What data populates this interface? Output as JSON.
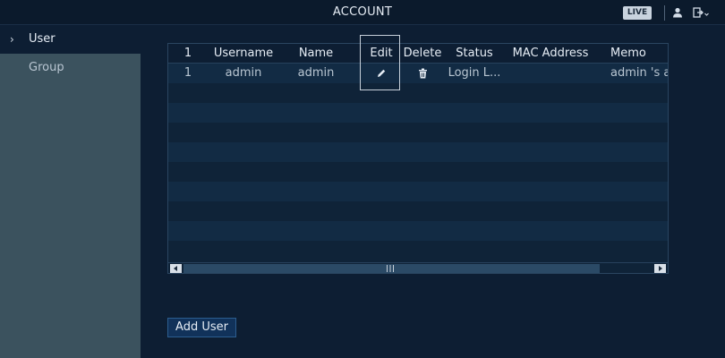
{
  "header": {
    "title": "ACCOUNT",
    "live_label": "LIVE"
  },
  "sidebar": {
    "items": [
      {
        "label": "User",
        "active": true
      },
      {
        "label": "Group",
        "active": false
      }
    ]
  },
  "table": {
    "columns": [
      "1",
      "Username",
      "Name",
      "Edit",
      "Delete",
      "Status",
      "MAC Address",
      "Memo"
    ],
    "memo_header_visible": "Memo",
    "rows": [
      {
        "index": "1",
        "username": "admin",
        "name": "admin",
        "status": "Login L...",
        "mac": "",
        "memo": "admin 's ac"
      }
    ]
  },
  "actions": {
    "add_user_label": "Add User"
  },
  "colors": {
    "background": "#0d1e33",
    "sidebar_inactive": "#3b525e",
    "row_alt": "#122b44",
    "button": "#11325a"
  },
  "icons": [
    "user-icon",
    "logout-icon",
    "chevron-right-icon",
    "pencil-icon",
    "trash-icon"
  ]
}
